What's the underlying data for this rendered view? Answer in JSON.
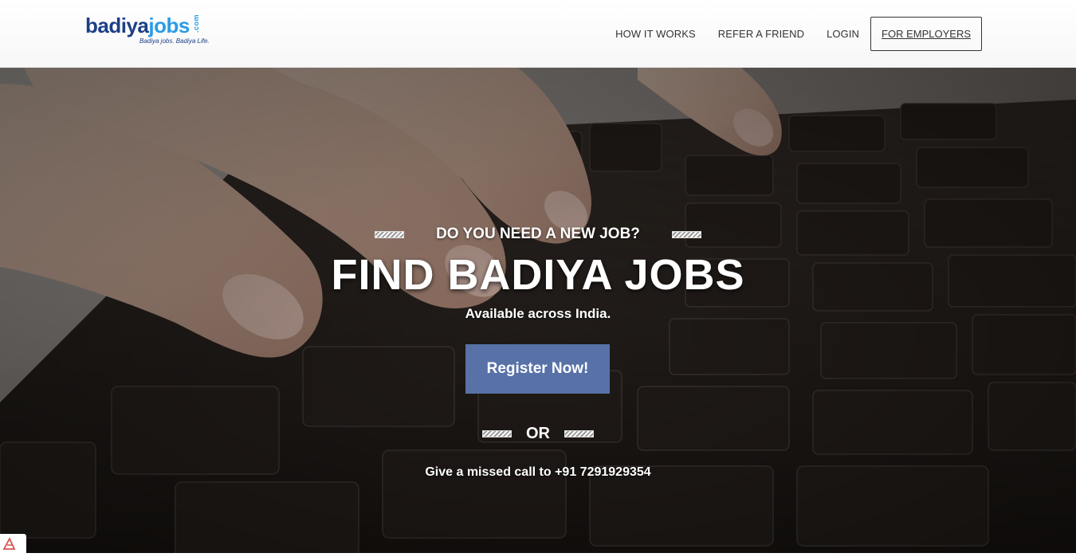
{
  "brand": {
    "word1": "badiya",
    "word2": "jobs",
    "tld": ".com",
    "tagline": "Badiya jobs. Badiya Life."
  },
  "nav": {
    "how_it_works": "HOW IT WORKS",
    "refer_a_friend": "REFER A FRIEND",
    "login": "LOGIN",
    "for_employers": "FOR EMPLOYERS"
  },
  "hero": {
    "pre_title": "DO YOU NEED A NEW JOB?",
    "title": "FIND BADIYA JOBS",
    "subtitle": "Available across India.",
    "register_label": "Register Now!",
    "or_label": "OR",
    "missed_call": "Give a missed call to +91 7291929354"
  },
  "colors": {
    "brand_dark": "#1d3f86",
    "brand_light": "#2a9ce6",
    "register_button": "#5872a8"
  }
}
